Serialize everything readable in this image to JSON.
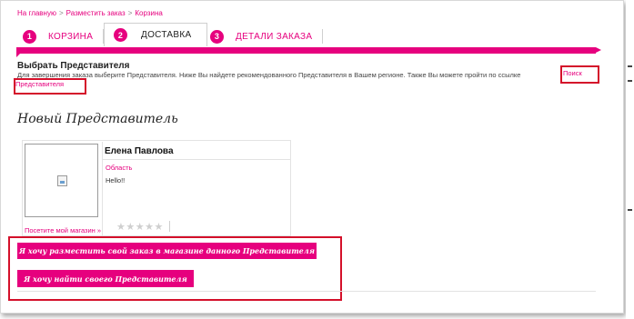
{
  "breadcrumb": [
    "На главную",
    "Разместить заказ",
    "Корзина"
  ],
  "breadcrumb_sep": ">",
  "tabs": [
    {
      "num": "1",
      "label": "КОРЗИНА"
    },
    {
      "num": "2",
      "label": "ДОСТАВКА"
    },
    {
      "num": "3",
      "label": "ДЕТАЛИ ЗАКАЗА"
    }
  ],
  "section": {
    "title": "Выбрать Представителя",
    "description": "Для завершения заказа выберите Представителя. Ниже Вы найдете рекомендованного Представителя в Вашем регионе. Также Вы можете пройти по ссылке",
    "link_part1": "Поиск",
    "link_part2": "Представителя"
  },
  "new_rep_heading": "Новый Представитель",
  "representative": {
    "name": "Елена Павлова",
    "region": "Область",
    "message": "Hello!!",
    "visit_link": "Посетите мой магазин »",
    "stars": "★★★★★",
    "rating": 0
  },
  "buttons": {
    "place_order": "Я хочу разместить свой заказ в магазине данного Представителя",
    "find_rep": "Я хочу найти своего Представителя"
  },
  "colors": {
    "accent": "#e6007e",
    "highlight_box": "#d4102a"
  }
}
